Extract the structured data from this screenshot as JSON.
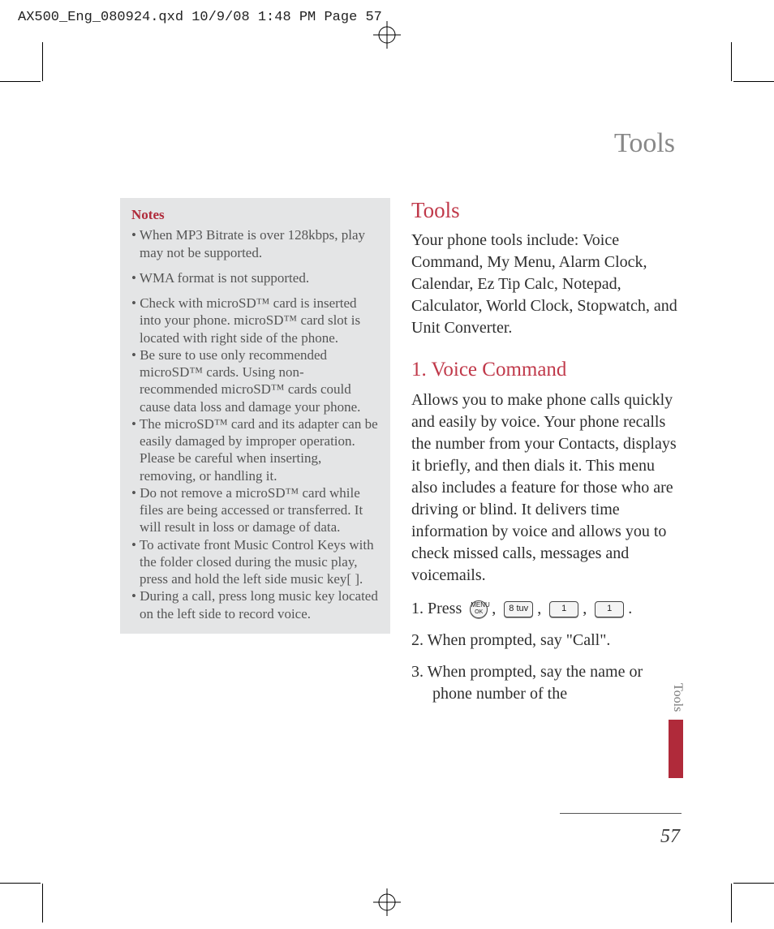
{
  "header_line": "AX500_Eng_080924.qxd  10/9/08  1:48 PM  Page 57",
  "running_title": "Tools",
  "notes": {
    "title": "Notes",
    "items": [
      "• When MP3 Bitrate is over 128kbps, play may not be supported.",
      "• WMA format is not supported.",
      "• Check with microSD™ card is inserted into your phone. microSD™ card slot is located with right side of the phone.",
      "• Be sure to use only recommended microSD™ cards. Using non-recommended microSD™ cards could cause data loss and damage your phone.",
      "• The microSD™ card and its adapter can be easily damaged by improper operation. Please be careful when inserting, removing, or handling it.",
      "• Do not remove a microSD™ card while files are being accessed or transferred. It will result in loss or damage of data.",
      "• To activate front Music Control Keys with the folder closed during the music play, press and hold the left side music key[  ].",
      "• During a call, press long music key   located on the left side to record voice."
    ]
  },
  "tools": {
    "heading": "Tools",
    "intro": "Your phone tools include: Voice Command, My Menu, Alarm Clock, Calendar, Ez Tip Calc, Notepad, Calculator, World Clock, Stopwatch, and Unit Converter."
  },
  "voice_command": {
    "heading": "1. Voice Command",
    "intro": "Allows you to make phone calls quickly and easily by voice. Your phone recalls the number from your Contacts, displays it briefly, and then dials it. This menu also includes a feature for those who are driving or blind. It delivers time information by voice and allows you to check missed calls, messages and voicemails.",
    "steps": [
      "1. Press",
      "2. When prompted, say \"Call\".",
      "3. When prompted, say the name or phone number of the"
    ],
    "step1_suffix": "."
  },
  "keys": {
    "menu_ok": "MENU OK",
    "k8": "8 tuv",
    "k1a": "1",
    "k1b": "1"
  },
  "sidetab": "Tools",
  "page_number": "57"
}
